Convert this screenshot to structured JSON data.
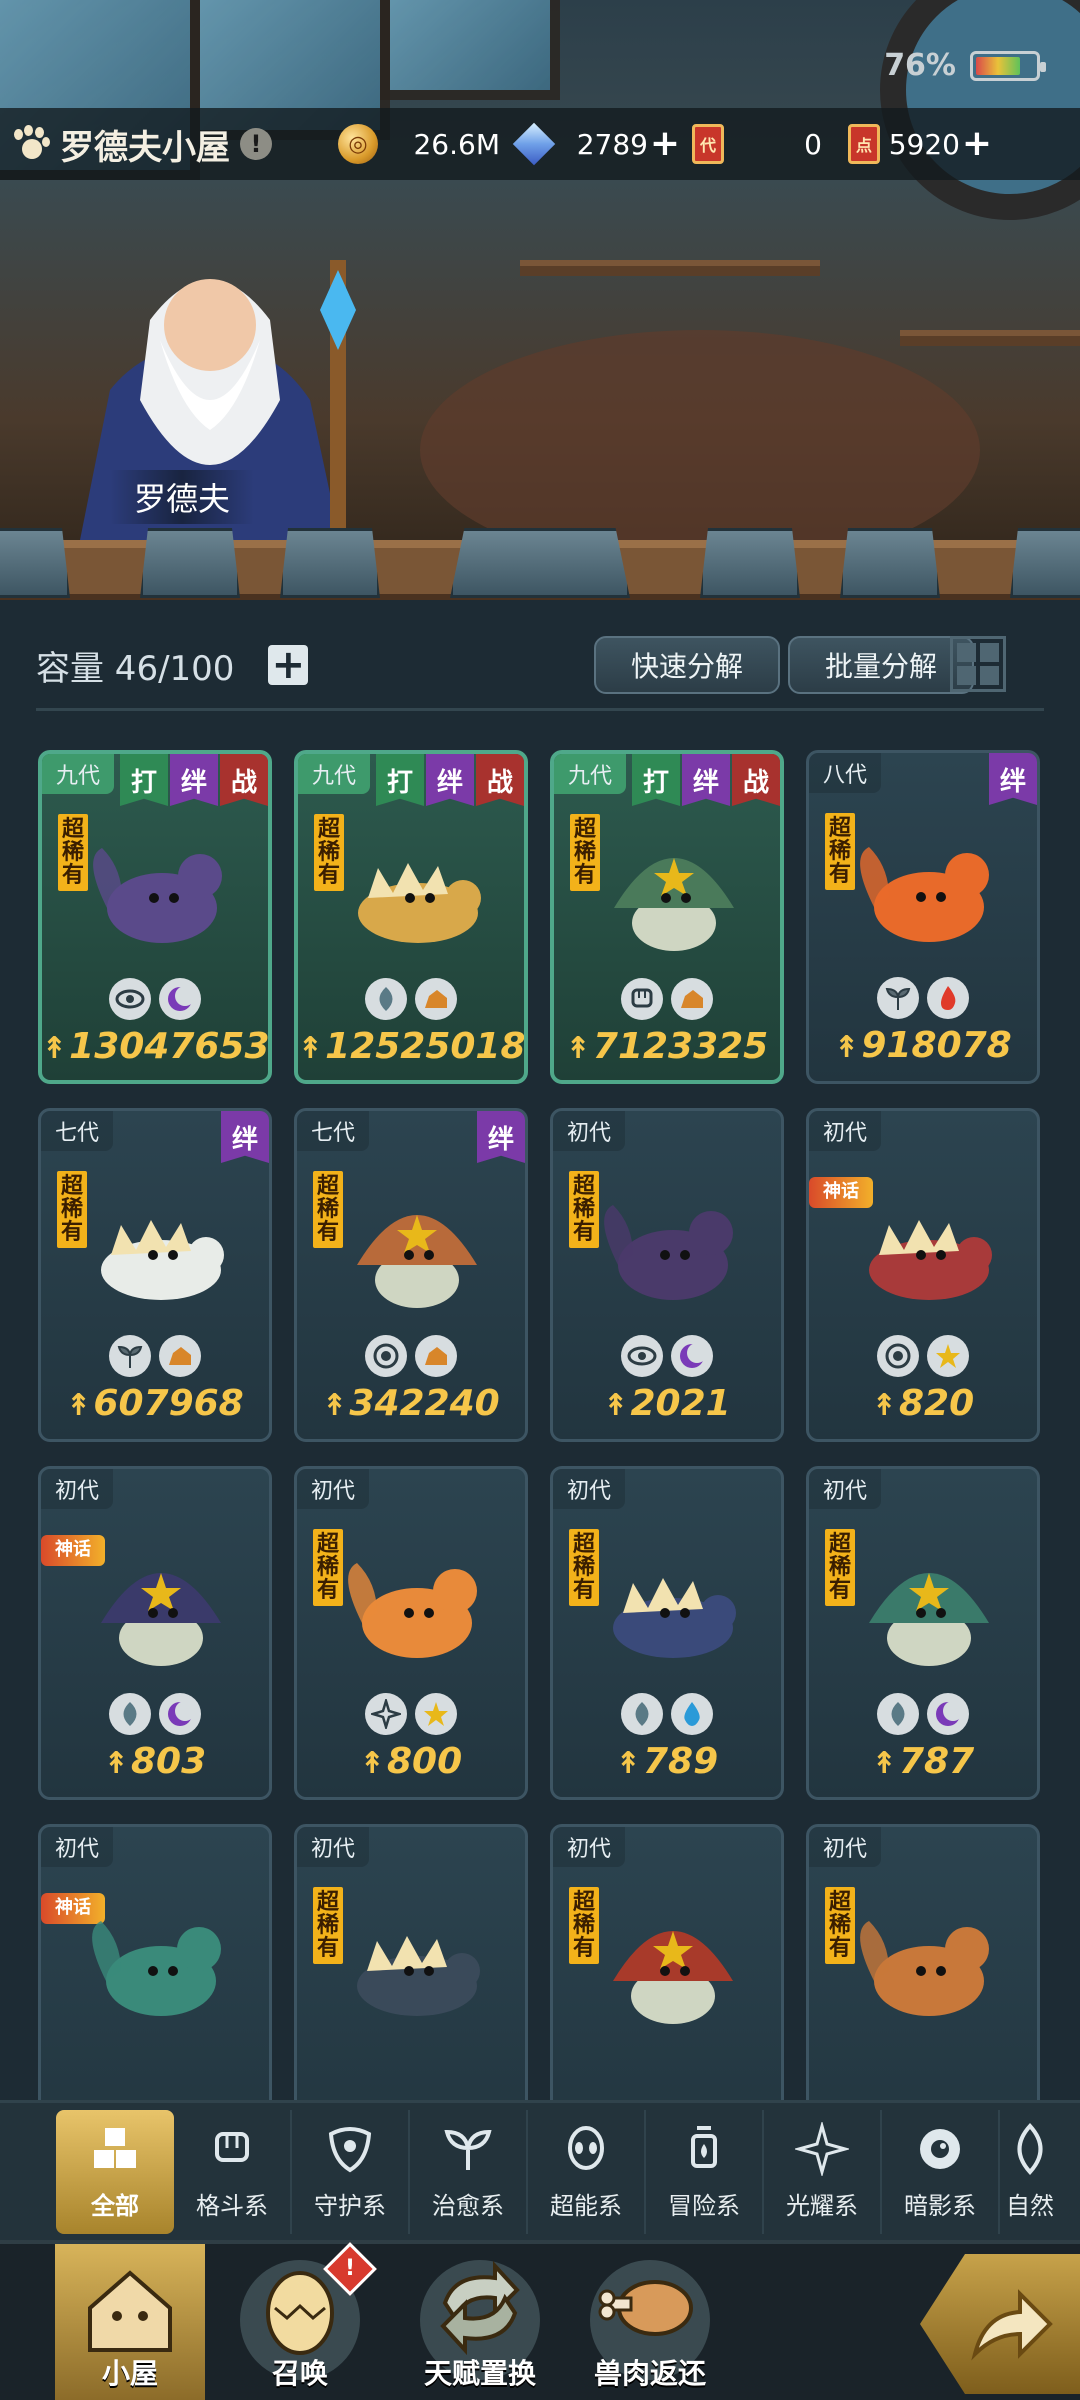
{
  "status": {
    "battery_pct": "76%",
    "battery_level": 0.76
  },
  "header": {
    "house_title": "罗德夫小屋",
    "info_label": "!",
    "coins": "26.6M",
    "gems": "2789",
    "ticket_label": "代",
    "tickets": "0",
    "points_label": "点",
    "points": "5920"
  },
  "npc": {
    "name": "罗德夫"
  },
  "inventory": {
    "capacity": "容量 46/100",
    "quick_decompose": "快速分解",
    "batch_decompose": "批量分解",
    "cards": [
      {
        "gen": "九代",
        "tags": [
          "打",
          "绊",
          "战"
        ],
        "rarity": "超稀有",
        "power": "13047653",
        "elems": [
          "eye",
          "moon"
        ],
        "elite": true,
        "color": "#5a4a8a"
      },
      {
        "gen": "九代",
        "tags": [
          "打",
          "绊",
          "战"
        ],
        "rarity": "超稀有",
        "power": "12525018",
        "elems": [
          "leaf",
          "rock"
        ],
        "elite": true,
        "color": "#d8a84a"
      },
      {
        "gen": "九代",
        "tags": [
          "打",
          "绊",
          "战"
        ],
        "rarity": "超稀有",
        "power": "7123325",
        "elems": [
          "fist",
          "rock"
        ],
        "elite": true,
        "color": "#4a7a5a"
      },
      {
        "gen": "八代",
        "tags": [
          "绊"
        ],
        "rarity": "超稀有",
        "power": "918078",
        "elems": [
          "sprout",
          "fire"
        ],
        "elite": false,
        "color": "#e86a2a"
      },
      {
        "gen": "七代",
        "tags": [
          "绊"
        ],
        "rarity": "超稀有",
        "power": "607968",
        "elems": [
          "sprout",
          "rock"
        ],
        "elite": false,
        "color": "#e8ece8"
      },
      {
        "gen": "七代",
        "tags": [
          "绊"
        ],
        "rarity": "超稀有",
        "power": "342240",
        "elems": [
          "shield",
          "rock"
        ],
        "elite": false,
        "color": "#b86a3a"
      },
      {
        "gen": "初代",
        "tags": [],
        "rarity": "超稀有",
        "power": "2021",
        "elems": [
          "eye",
          "moon"
        ],
        "elite": false,
        "color": "#4a3a6a"
      },
      {
        "gen": "初代",
        "tags": [],
        "rarity": "神话",
        "power": "820",
        "elems": [
          "shield",
          "star"
        ],
        "elite": false,
        "color": "#a83a3a",
        "myth": true
      },
      {
        "gen": "初代",
        "tags": [],
        "rarity": "神话",
        "power": "803",
        "elems": [
          "leaf",
          "moon"
        ],
        "elite": false,
        "color": "#3a3a6a",
        "myth": true
      },
      {
        "gen": "初代",
        "tags": [],
        "rarity": "超稀有",
        "power": "800",
        "elems": [
          "cross",
          "star"
        ],
        "elite": false,
        "color": "#e88a3a"
      },
      {
        "gen": "初代",
        "tags": [],
        "rarity": "超稀有",
        "power": "789",
        "elems": [
          "leaf",
          "drop"
        ],
        "elite": false,
        "color": "#3a4a7a"
      },
      {
        "gen": "初代",
        "tags": [],
        "rarity": "超稀有",
        "power": "787",
        "elems": [
          "leaf",
          "moon"
        ],
        "elite": false,
        "color": "#3a7a6a"
      },
      {
        "gen": "初代",
        "tags": [],
        "rarity": "神话",
        "power": "",
        "elems": [],
        "elite": false,
        "color": "#3a8a7a",
        "myth": true
      },
      {
        "gen": "初代",
        "tags": [],
        "rarity": "超稀有",
        "power": "",
        "elems": [],
        "elite": false,
        "color": "#3a4a5a"
      },
      {
        "gen": "初代",
        "tags": [],
        "rarity": "超稀有",
        "power": "",
        "elems": [],
        "elite": false,
        "color": "#a83a2a"
      },
      {
        "gen": "初代",
        "tags": [],
        "rarity": "超稀有",
        "power": "",
        "elems": [],
        "elite": false,
        "color": "#c8783a"
      }
    ]
  },
  "categories": [
    {
      "label": "全部",
      "icon": "all-icon",
      "active": true
    },
    {
      "label": "格斗系",
      "icon": "fist-icon"
    },
    {
      "label": "守护系",
      "icon": "shield-icon"
    },
    {
      "label": "治愈系",
      "icon": "sprout-icon"
    },
    {
      "label": "超能系",
      "icon": "psychic-icon"
    },
    {
      "label": "冒险系",
      "icon": "lantern-icon"
    },
    {
      "label": "光耀系",
      "icon": "light-icon"
    },
    {
      "label": "暗影系",
      "icon": "eye-icon"
    },
    {
      "label": "自然",
      "icon": "leaf-icon"
    }
  ],
  "nav": [
    {
      "label": "小屋",
      "active": true
    },
    {
      "label": "召唤",
      "badge": "!"
    },
    {
      "label": "天赋置换"
    },
    {
      "label": "兽肉返还"
    }
  ]
}
